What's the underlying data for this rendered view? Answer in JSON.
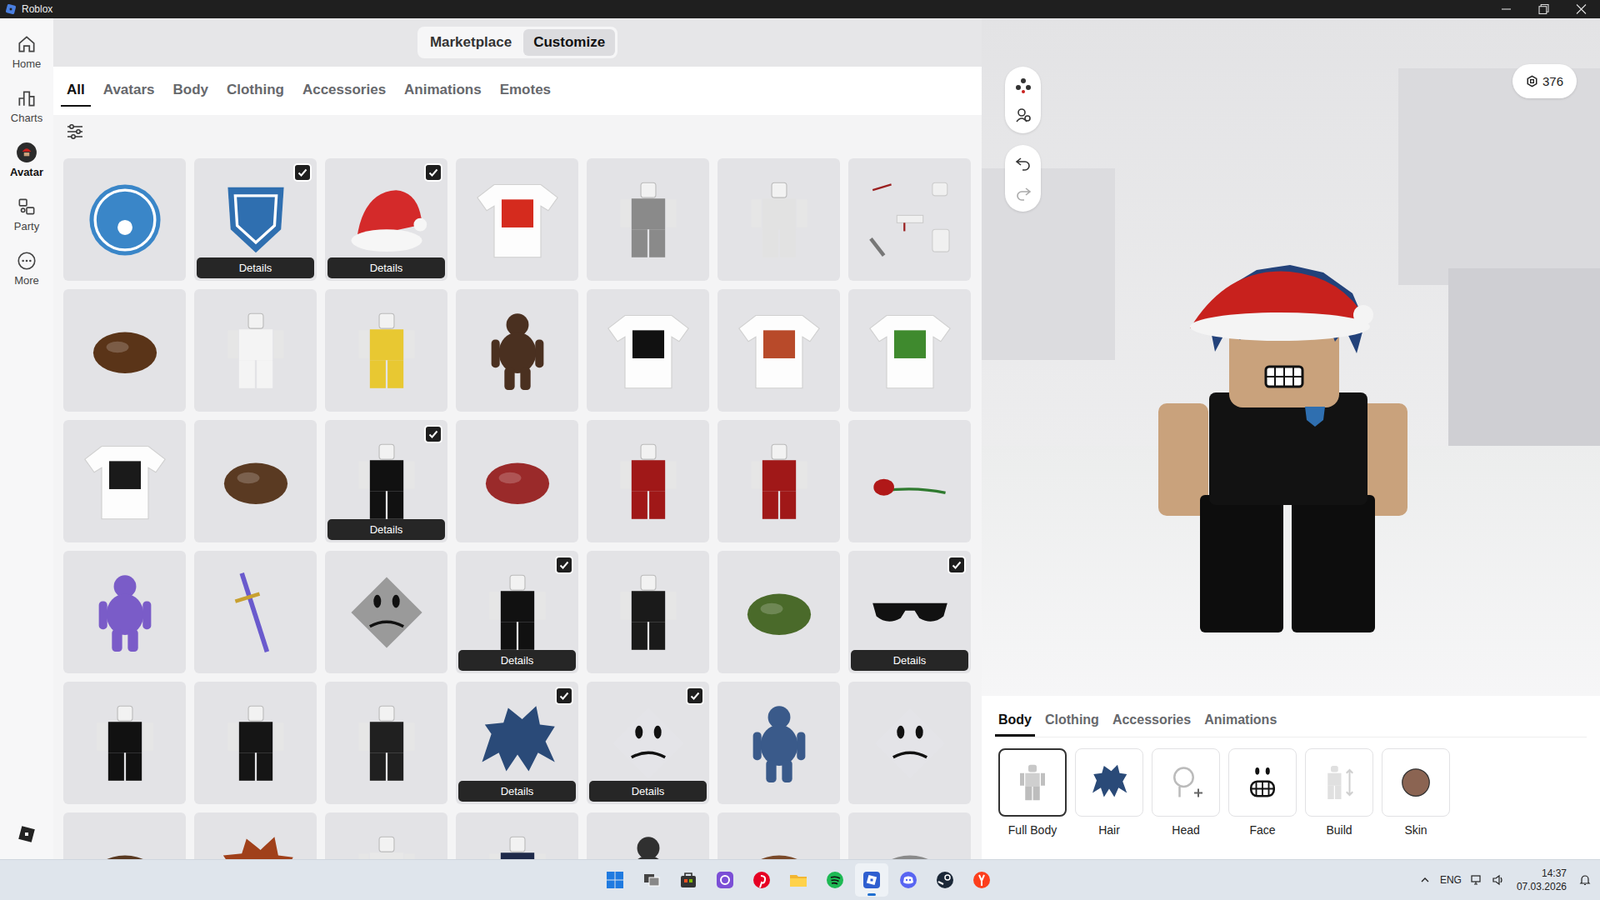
{
  "window": {
    "title": "Roblox"
  },
  "sidebar": {
    "items": [
      {
        "label": "Home",
        "kind": "home",
        "selected": false
      },
      {
        "label": "Charts",
        "kind": "charts",
        "selected": false
      },
      {
        "label": "Avatar",
        "kind": "avatar",
        "selected": true
      },
      {
        "label": "Party",
        "kind": "party",
        "selected": false
      },
      {
        "label": "More",
        "kind": "more",
        "selected": false
      }
    ]
  },
  "mode_switch": [
    {
      "label": "Marketplace",
      "selected": false
    },
    {
      "label": "Customize",
      "selected": true
    }
  ],
  "tabs": [
    {
      "label": "All",
      "selected": true
    },
    {
      "label": "Avatars",
      "selected": false
    },
    {
      "label": "Body",
      "selected": false
    },
    {
      "label": "Clothing",
      "selected": false
    },
    {
      "label": "Accessories",
      "selected": false
    },
    {
      "label": "Animations",
      "selected": false
    },
    {
      "label": "Emotes",
      "selected": false
    }
  ],
  "grid": {
    "details_label": "Details",
    "items": [
      {
        "kind": "coin",
        "color": "#3a86c8",
        "checked": false
      },
      {
        "kind": "badge",
        "color": "#2f6fb0",
        "checked": true
      },
      {
        "kind": "hat",
        "color": "#d42a2a",
        "checked": true
      },
      {
        "kind": "shirt",
        "color": "#d52b1e",
        "checked": false
      },
      {
        "kind": "figure",
        "color": "#8a8a8a",
        "checked": false
      },
      {
        "kind": "figure",
        "color": "#e2e2e2",
        "checked": false
      },
      {
        "kind": "accessories",
        "color": "#9b2020",
        "checked": false
      },
      {
        "kind": "blob",
        "color": "#5a3418",
        "checked": false
      },
      {
        "kind": "figure",
        "color": "#f4f4f4",
        "checked": false
      },
      {
        "kind": "figure",
        "color": "#e8c832",
        "checked": false
      },
      {
        "kind": "creature",
        "color": "#4a3020",
        "checked": false
      },
      {
        "kind": "shirt",
        "color": "#111111",
        "checked": false
      },
      {
        "kind": "shirt",
        "color": "#b84a2a",
        "checked": false
      },
      {
        "kind": "shirt",
        "color": "#3f8a2e",
        "checked": false
      },
      {
        "kind": "shirt",
        "color": "#1a1a1a",
        "checked": false
      },
      {
        "kind": "blob",
        "color": "#5a3a22",
        "checked": false
      },
      {
        "kind": "figure",
        "color": "#111111",
        "checked": true
      },
      {
        "kind": "blob",
        "color": "#9a2a2a",
        "checked": false
      },
      {
        "kind": "figure",
        "color": "#a01818",
        "checked": false
      },
      {
        "kind": "figure",
        "color": "#a01818",
        "checked": false
      },
      {
        "kind": "rose",
        "color": "#b01818",
        "checked": false
      },
      {
        "kind": "creature",
        "color": "#7a5cc8",
        "checked": false
      },
      {
        "kind": "sword",
        "color": "#6a5acd",
        "checked": false
      },
      {
        "kind": "face",
        "color": "#9a9a9a",
        "checked": false
      },
      {
        "kind": "figure",
        "color": "#111111",
        "checked": true
      },
      {
        "kind": "figure",
        "color": "#1a1a1a",
        "checked": false
      },
      {
        "kind": "blob",
        "color": "#4a6a2a",
        "checked": false
      },
      {
        "kind": "glasses",
        "color": "#111111",
        "checked": true
      },
      {
        "kind": "figure",
        "color": "#111111",
        "checked": false
      },
      {
        "kind": "figure",
        "color": "#151515",
        "checked": false
      },
      {
        "kind": "figure",
        "color": "#202020",
        "checked": false
      },
      {
        "kind": "hair",
        "color": "#2a4a78",
        "checked": true
      },
      {
        "kind": "face",
        "color": "#e4e4e8",
        "checked": true
      },
      {
        "kind": "creature",
        "color": "#3a5a8a",
        "checked": false
      },
      {
        "kind": "face",
        "color": "#e4e4e8",
        "checked": false
      },
      {
        "kind": "blob",
        "color": "#5a3a22",
        "checked": false
      },
      {
        "kind": "hair",
        "color": "#a0401a",
        "checked": false
      },
      {
        "kind": "figure",
        "color": "#e8e8e8",
        "checked": false
      },
      {
        "kind": "figure",
        "color": "#1e2a4a",
        "checked": false
      },
      {
        "kind": "creature",
        "color": "#303030",
        "checked": false
      },
      {
        "kind": "blob",
        "color": "#7a4a2a",
        "checked": false
      },
      {
        "kind": "blob",
        "color": "#8a8a8a",
        "checked": false
      }
    ]
  },
  "robux": {
    "balance": "376"
  },
  "editor": {
    "tabs": [
      {
        "label": "Body",
        "selected": true
      },
      {
        "label": "Clothing",
        "selected": false
      },
      {
        "label": "Accessories",
        "selected": false
      },
      {
        "label": "Animations",
        "selected": false
      }
    ],
    "slots": [
      {
        "label": "Full Body",
        "kind": "body",
        "selected": true
      },
      {
        "label": "Hair",
        "kind": "hair",
        "selected": false
      },
      {
        "label": "Head",
        "kind": "head",
        "selected": false
      },
      {
        "label": "Face",
        "kind": "face",
        "selected": false
      },
      {
        "label": "Build",
        "kind": "build",
        "selected": false
      },
      {
        "label": "Skin",
        "kind": "skin",
        "selected": false
      }
    ]
  },
  "taskbar": {
    "apps": [
      {
        "kind": "start",
        "active": false
      },
      {
        "kind": "taskview",
        "active": false
      },
      {
        "kind": "store",
        "active": false
      },
      {
        "kind": "purple",
        "active": false
      },
      {
        "kind": "pinterest",
        "active": false
      },
      {
        "kind": "explorer",
        "active": false
      },
      {
        "kind": "spotify",
        "active": false
      },
      {
        "kind": "roblox",
        "active": true
      },
      {
        "kind": "discord",
        "active": false
      },
      {
        "kind": "steam",
        "active": false
      },
      {
        "kind": "yandex",
        "active": false
      }
    ],
    "language": "ENG",
    "time": "14:37",
    "date": "07.03.2026"
  }
}
